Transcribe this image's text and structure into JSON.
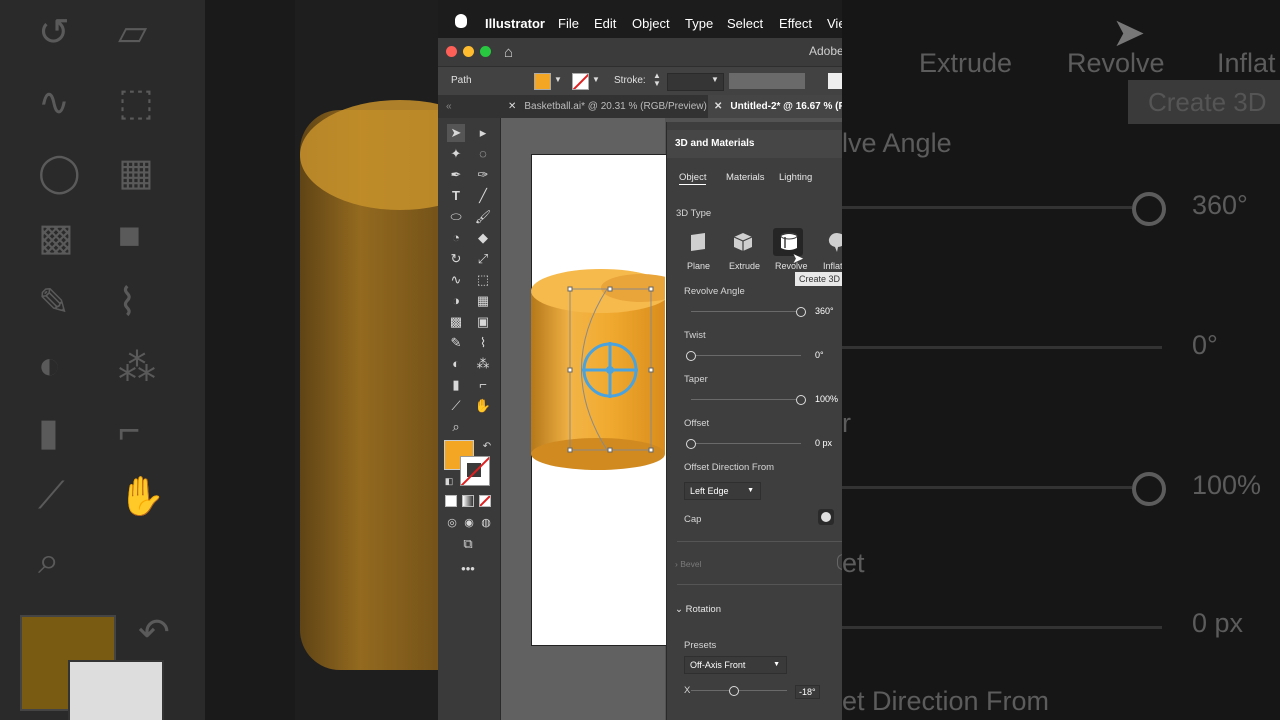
{
  "menubar": {
    "app_name": "Illustrator",
    "items": [
      "File",
      "Edit",
      "Object",
      "Type",
      "Select",
      "Effect",
      "Vie"
    ]
  },
  "titlebar": {
    "app_title": "Adobe"
  },
  "control_bar": {
    "selection_label": "Path",
    "stroke_label": "Stroke:",
    "fill_color": "#f2a624"
  },
  "doc_tabs": [
    {
      "label": "Basketball.ai* @ 20.31 % (RGB/Preview)",
      "active": false
    },
    {
      "label": "Untitled-2* @ 16.67 % (RG",
      "active": true
    }
  ],
  "panel": {
    "title": "3D and Materials",
    "tabs": [
      "Object",
      "Materials",
      "Lighting"
    ],
    "type_section_label": "3D Type",
    "types": [
      {
        "label": "Plane",
        "icon": "plane-icon"
      },
      {
        "label": "Extrude",
        "icon": "extrude-icon"
      },
      {
        "label": "Revolve",
        "icon": "revolve-icon",
        "selected": true
      },
      {
        "label": "Inflat",
        "icon": "inflate-icon"
      }
    ],
    "tooltip": "Create 3D",
    "revolve_angle": {
      "label": "Revolve Angle",
      "value": "360°",
      "fraction": 1.0
    },
    "twist": {
      "label": "Twist",
      "value": "0°",
      "fraction": 0.0
    },
    "taper": {
      "label": "Taper",
      "value": "100%",
      "fraction": 1.0
    },
    "offset": {
      "label": "Offset",
      "value": "0 px",
      "fraction": 0.0
    },
    "offset_direction": {
      "label": "Offset Direction From",
      "value": "Left Edge"
    },
    "cap_label": "Cap",
    "bevel_label": "Bevel",
    "rotation_label": "Rotation",
    "presets": {
      "label": "Presets",
      "value": "Off-Axis Front"
    },
    "x_rotation": {
      "label": "X",
      "value": "-18°",
      "fraction": 0.45
    }
  },
  "background_right": {
    "types": [
      "Extrude",
      "Revolve",
      "Inflat"
    ],
    "tooltip": "Create 3D",
    "revolve_label": "lve Angle",
    "values": [
      "360°",
      "0°",
      "100%",
      "0 px"
    ],
    "offset_dir": "et Direction From",
    "taper_frag": "r",
    "bevel_frag": "et"
  },
  "colors": {
    "fill": "#f2a624",
    "accent_selection": "#4aa3df",
    "panel_bg": "#3e3e3e"
  }
}
